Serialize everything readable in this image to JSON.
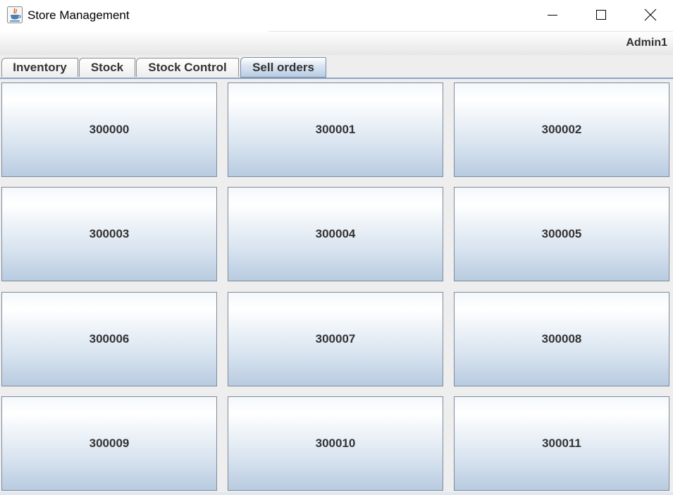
{
  "window": {
    "title": "Store Management",
    "icon": "java-cup-icon",
    "controls": [
      "minimize-icon",
      "maximize-icon",
      "close-icon"
    ]
  },
  "header": {
    "user": "Admin1"
  },
  "tabs": [
    {
      "label": "Inventory",
      "selected": false
    },
    {
      "label": "Stock",
      "selected": false
    },
    {
      "label": "Stock Control",
      "selected": false
    },
    {
      "label": "Sell orders",
      "selected": true
    }
  ],
  "orders": [
    "300000",
    "300001",
    "300002",
    "300003",
    "300004",
    "300005",
    "300006",
    "300007",
    "300008",
    "300009",
    "300010",
    "300011"
  ],
  "colors": {
    "selected_tab_accent": "#b9cce3",
    "button_gradient_end": "#b8cbe0"
  }
}
